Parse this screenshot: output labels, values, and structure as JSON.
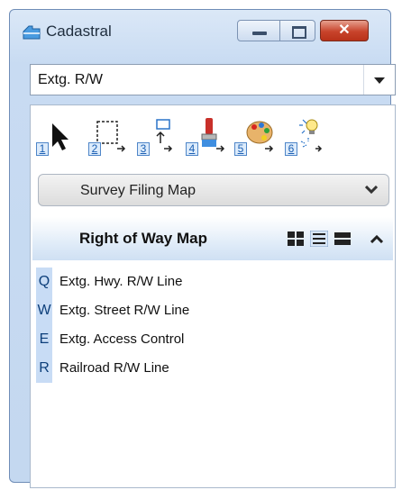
{
  "window": {
    "title": "Cadastral",
    "close_glyph": "✕"
  },
  "combo": {
    "value": "Extg. R/W"
  },
  "tools": [
    {
      "num": "1",
      "icon": "arrow-select-icon"
    },
    {
      "num": "2",
      "icon": "dashed-selection-icon"
    },
    {
      "num": "3",
      "icon": "move-box-icon"
    },
    {
      "num": "4",
      "icon": "paint-brush-icon"
    },
    {
      "num": "5",
      "icon": "palette-icon"
    },
    {
      "num": "6",
      "icon": "lightbulb-icon"
    }
  ],
  "sections": {
    "collapsed": {
      "title": "Survey Filing Map"
    },
    "expanded": {
      "title": "Right of Way Map"
    }
  },
  "items": [
    {
      "key": "Q",
      "label": "Extg. Hwy. R/W Line"
    },
    {
      "key": "W",
      "label": "Extg. Street R/W Line"
    },
    {
      "key": "E",
      "label": "Extg. Access Control"
    },
    {
      "key": "R",
      "label": "Railroad R/W Line"
    }
  ],
  "colors": {
    "title_bar": "#dbe8f7",
    "close_button": "#c8432b",
    "hotkey_bg": "#c8dcf5",
    "accent_blue": "#1b5fb3"
  }
}
